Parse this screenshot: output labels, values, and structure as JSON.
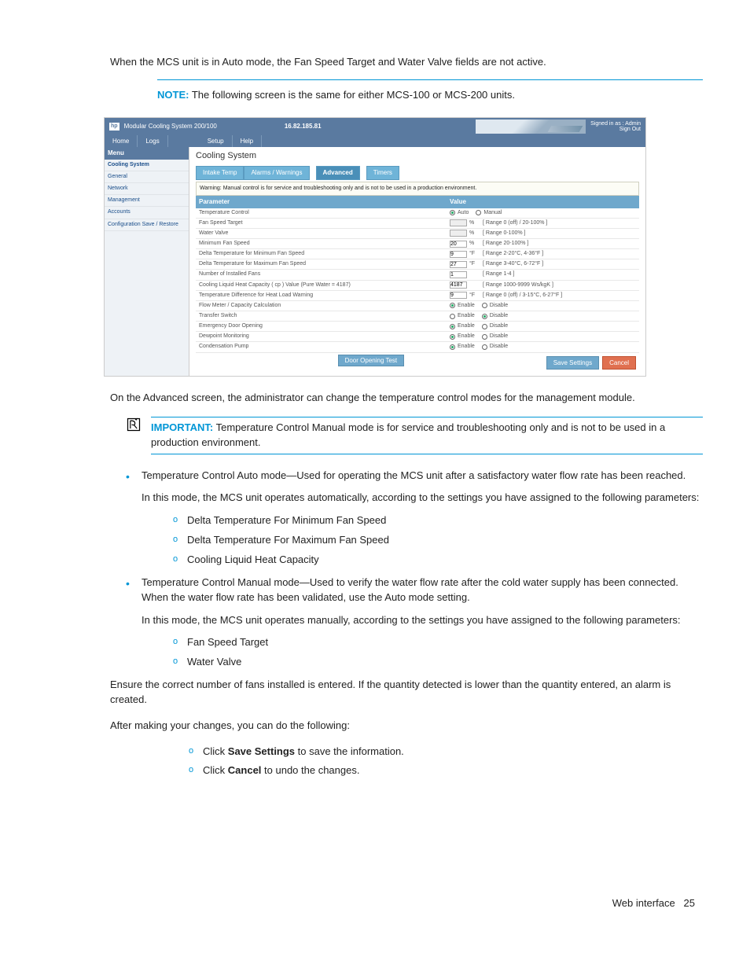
{
  "intro": "When the MCS unit is in Auto mode, the Fan Speed Target and Water Valve fields are not active.",
  "note": {
    "label": "NOTE:",
    "text": "The following screen is the same for either MCS-100 or MCS-200 units."
  },
  "screenshot": {
    "titlebar": {
      "logo": "hp",
      "title": "Modular Cooling System 200/100",
      "ip": "16.82.185.81",
      "signed": "Signed in as : Admin",
      "signout": "Sign Out"
    },
    "tabs1": [
      "Home",
      "Logs",
      "Setup",
      "Help"
    ],
    "side_header": "Menu",
    "side_items": [
      "Cooling System",
      "General",
      "Network",
      "Management",
      "Accounts",
      "Configuration Save / Restore"
    ],
    "main_title": "Cooling System",
    "tabs2": [
      "Intake Temp",
      "Alarms / Warnings",
      "Advanced",
      "Timers"
    ],
    "warning": "Warning: Manual control is for service and troubleshooting only and is not to be used in a production environment.",
    "table_headers": [
      "Parameter",
      "Value"
    ],
    "rows": [
      {
        "p": "Temperature Control",
        "type": "radio",
        "opts": [
          "Auto",
          "Manual"
        ],
        "sel": 0
      },
      {
        "p": "Fan Speed Target",
        "type": "input",
        "val": "",
        "unit": "%",
        "range": "[ Range 0 (off) / 20-100% ]",
        "dis": true
      },
      {
        "p": "Water Valve",
        "type": "input",
        "val": "",
        "unit": "%",
        "range": "[ Range 0-100% ]",
        "dis": true
      },
      {
        "p": "Minimum Fan Speed",
        "type": "input",
        "val": "20",
        "unit": "%",
        "range": "[ Range 20-100% ]"
      },
      {
        "p": "Delta Temperature for Minimum Fan Speed",
        "type": "input",
        "val": "9",
        "unit": "°F",
        "range": "[ Range 2-20°C, 4-36°F ]"
      },
      {
        "p": "Delta Temperature for Maximum Fan Speed",
        "type": "input",
        "val": "27",
        "unit": "°F",
        "range": "[ Range 3-40°C, 6-72°F ]"
      },
      {
        "p": "Number of Installed Fans",
        "type": "input",
        "val": "1",
        "unit": "",
        "range": "[ Range 1-4 ]"
      },
      {
        "p": "Cooling Liquid Heat Capacity ( cp ) Value (Pure Water = 4187)",
        "type": "input",
        "val": "4187",
        "unit": "",
        "range": "[ Range 1000-9999 Ws/kgK ]"
      },
      {
        "p": "Temperature Difference for Heat Load Warning",
        "type": "input",
        "val": "9",
        "unit": "°F",
        "range": "[ Range 0 (off) / 3-15°C, 6-27°F ]"
      },
      {
        "p": "Flow Meter / Capacity Calculation",
        "type": "radio",
        "opts": [
          "Enable",
          "Disable"
        ],
        "sel": 0
      },
      {
        "p": "Transfer Switch",
        "type": "radio",
        "opts": [
          "Enable",
          "Disable"
        ],
        "sel": 1
      },
      {
        "p": "Emergency Door Opening",
        "type": "radio",
        "opts": [
          "Enable",
          "Disable"
        ],
        "sel": 0
      },
      {
        "p": "Dewpoint Monitoring",
        "type": "radio",
        "opts": [
          "Enable",
          "Disable"
        ],
        "sel": 0
      },
      {
        "p": "Condensation Pump",
        "type": "radio",
        "opts": [
          "Enable",
          "Disable"
        ],
        "sel": 0
      }
    ],
    "door_btn": "Door Opening Test",
    "save_btn": "Save Settings",
    "cancel_btn": "Cancel"
  },
  "para_advanced": "On the Advanced screen, the administrator can change the temperature control modes for the management module.",
  "important": {
    "label": "IMPORTANT:",
    "text": "Temperature Control Manual mode is for service and troubleshooting only and is not to be used in a production environment."
  },
  "bullet1": {
    "lead": "Temperature Control Auto mode—Used for operating the MCS unit after a satisfactory water flow rate has been reached.",
    "p2": "In this mode, the MCS unit operates automatically, according to the settings you have assigned to the following parameters:",
    "subs": [
      "Delta Temperature For Minimum Fan Speed",
      "Delta Temperature For Maximum Fan Speed",
      "Cooling Liquid Heat Capacity"
    ]
  },
  "bullet2": {
    "lead": "Temperature Control Manual mode—Used to verify the water flow rate after the cold water supply has been connected. When the water flow rate has been validated, use the Auto mode setting.",
    "p2": "In this mode, the MCS unit operates manually, according to the settings you have assigned to the following parameters:",
    "subs": [
      "Fan Speed Target",
      "Water Valve"
    ]
  },
  "para_fans": "Ensure the correct number of fans installed is entered. If the quantity detected is lower than the quantity entered, an alarm is created.",
  "para_after": "After making your changes, you can do the following:",
  "after_subs": [
    {
      "pre": "Click ",
      "b": "Save Settings",
      "post": " to save the information."
    },
    {
      "pre": "Click ",
      "b": "Cancel",
      "post": " to undo the changes."
    }
  ],
  "footer": {
    "label": "Web interface",
    "page": "25"
  }
}
